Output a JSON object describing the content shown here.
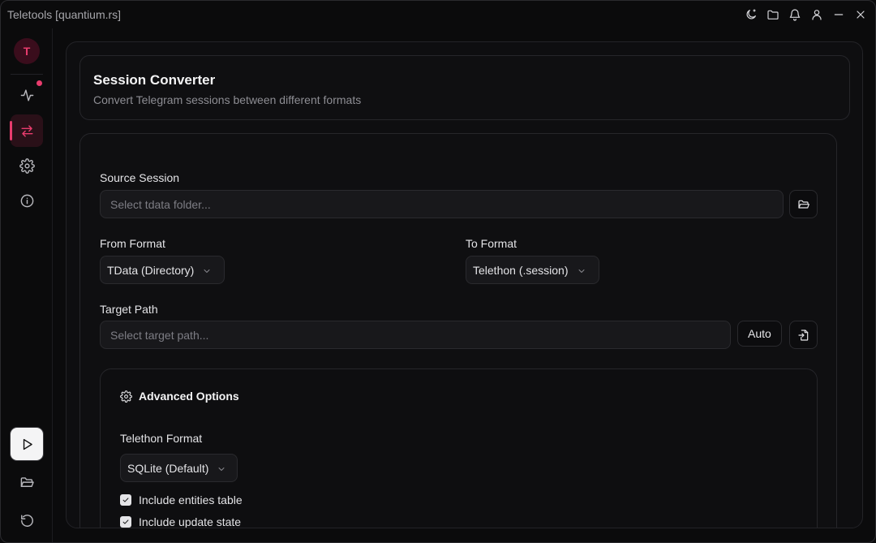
{
  "window": {
    "title": "Teletools [quantium.rs]",
    "titlebar_icons": [
      "theme-moon-icon",
      "folder-icon",
      "bell-icon",
      "user-icon",
      "minimize-icon",
      "close-icon"
    ]
  },
  "sidebar": {
    "avatar_letter": "T",
    "items": [
      {
        "name": "activity",
        "icon": "activity-icon",
        "badge": true
      },
      {
        "name": "converter",
        "icon": "swap-arrows-icon",
        "active": true
      },
      {
        "name": "settings",
        "icon": "gear-icon"
      },
      {
        "name": "info",
        "icon": "info-icon"
      }
    ],
    "bottom_items": [
      {
        "name": "run",
        "icon": "play-icon"
      },
      {
        "name": "open-folder",
        "icon": "folder-open-icon"
      },
      {
        "name": "reset",
        "icon": "rotate-ccw-icon"
      }
    ],
    "accent_color": "#e83c6d"
  },
  "header": {
    "title": "Session Converter",
    "subtitle": "Convert Telegram sessions between different formats"
  },
  "form": {
    "source": {
      "label": "Source Session",
      "placeholder": "Select tdata folder..."
    },
    "from_format": {
      "label": "From Format",
      "value": "TData (Directory)"
    },
    "to_format": {
      "label": "To Format",
      "value": "Telethon (.session)"
    },
    "target": {
      "label": "Target Path",
      "placeholder": "Select target path...",
      "auto_label": "Auto"
    },
    "advanced": {
      "title": "Advanced Options",
      "telethon_format_label": "Telethon Format",
      "telethon_format_value": "SQLite (Default)",
      "options": [
        {
          "label": "Include entities table",
          "checked": true
        },
        {
          "label": "Include update state",
          "checked": true
        }
      ]
    }
  }
}
